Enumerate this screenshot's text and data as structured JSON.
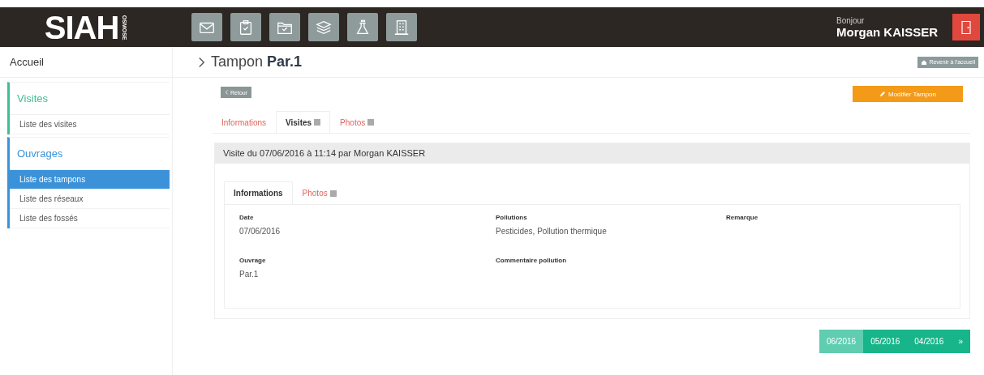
{
  "header": {
    "logo": "SIAH",
    "logo_sub": "OSMOSE",
    "toolbar": [
      {
        "kind": "mail"
      },
      {
        "kind": "clipboard"
      },
      {
        "kind": "folder"
      },
      {
        "kind": "layers"
      },
      {
        "kind": "flask"
      },
      {
        "kind": "building"
      }
    ],
    "greeting": "Bonjour",
    "user": "Morgan KAISSER"
  },
  "sidebar": {
    "home": "Accueil",
    "groups": [
      {
        "title": "Visites",
        "color": "#3dbf93",
        "items": [
          {
            "label": "Liste des visites",
            "selected": false
          }
        ]
      },
      {
        "title": "Ouvrages",
        "color": "#3a93d8",
        "items": [
          {
            "label": "Liste des tampons",
            "selected": true
          },
          {
            "label": "Liste des réseaux",
            "selected": false
          },
          {
            "label": "Liste des fossés",
            "selected": false
          }
        ]
      }
    ]
  },
  "page": {
    "title_prefix": "Tampon",
    "title_bold": "Par.1",
    "home_button": "Revenir à l'accueil",
    "back_button": "Retour",
    "edit_button": "Modifier Tampon",
    "tabs": [
      {
        "label": "Informations",
        "selected": false,
        "badge": false
      },
      {
        "label": "Visites",
        "selected": true,
        "badge": true
      },
      {
        "label": "Photos",
        "selected": false,
        "badge": true
      }
    ],
    "visit": {
      "title": "Visite du 07/06/2016 à 11:14 par Morgan KAISSER",
      "tabs": [
        {
          "label": "Informations",
          "selected": true,
          "badge": false
        },
        {
          "label": "Photos",
          "selected": false,
          "badge": true
        }
      ],
      "fields": [
        {
          "label": "Date",
          "value": "07/06/2016"
        },
        {
          "label": "Pollutions",
          "value": "Pesticides, Pollution thermique"
        },
        {
          "label": "Remarque"
        },
        {
          "label": "Ouvrage",
          "value": "Par.1"
        },
        {
          "label": "Commentaire pollution"
        }
      ]
    },
    "pagination": [
      {
        "label": "06/2016",
        "selected": true
      },
      {
        "label": "05/2016",
        "selected": false
      },
      {
        "label": "04/2016",
        "selected": false
      },
      {
        "label": "»",
        "selected": false
      }
    ]
  }
}
